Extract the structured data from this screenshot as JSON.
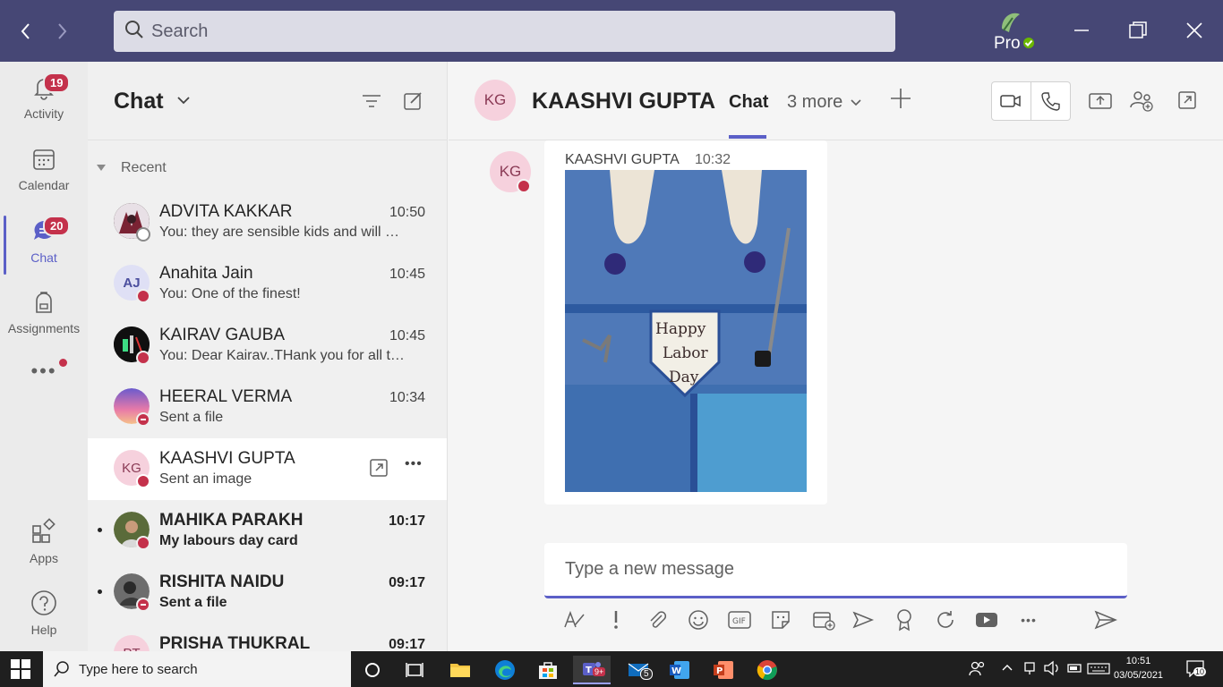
{
  "search": {
    "placeholder": "Search"
  },
  "profile": {
    "label": "Pro"
  },
  "rail": {
    "items": [
      {
        "label": "Activity",
        "badge": "19"
      },
      {
        "label": "Calendar"
      },
      {
        "label": "Chat",
        "badge": "20"
      },
      {
        "label": "Assignments"
      },
      {
        "label": "Apps"
      },
      {
        "label": "Help"
      }
    ]
  },
  "chatlist": {
    "title": "Chat",
    "section": "Recent",
    "chats": [
      {
        "name": "ADVITA KAKKAR",
        "time": "10:50",
        "preview": "You: they are sensible kids and will grow to be good human beings",
        "presence": "offline"
      },
      {
        "name": "Anahita Jain",
        "initials": "AJ",
        "time": "10:45",
        "preview": "You: One of the finest!",
        "presence": "busy"
      },
      {
        "name": "KAIRAV GAUBA",
        "time": "10:45",
        "preview": "You: Dear Kairav..THank you for all the wishes",
        "presence": "busy"
      },
      {
        "name": "HEERAL VERMA",
        "time": "10:34",
        "preview": "Sent a file",
        "presence": "dnd"
      },
      {
        "name": "KAASHVI GUPTA",
        "initials": "KG",
        "time": "",
        "preview": "Sent an image",
        "presence": "busy"
      },
      {
        "name": "MAHIKA PARAKH",
        "time": "10:17",
        "preview": "My labours day card",
        "presence": "busy"
      },
      {
        "name": "RISHITA NAIDU",
        "time": "09:17",
        "preview": "Sent a file",
        "presence": "dnd"
      },
      {
        "name": "PRISHA THUKRAL",
        "initials": "PT",
        "time": "09:17",
        "preview": "",
        "presence": "busy"
      }
    ]
  },
  "conversation": {
    "name": "KAASHVI GUPTA",
    "initials": "KG",
    "tab_chat": "Chat",
    "tab_more": "3 more",
    "message": {
      "sender": "KAASHVI GUPTA",
      "time": "10:32",
      "image_text": [
        "Happy",
        "Labor",
        "Day"
      ]
    },
    "composer_placeholder": "Type a new message"
  },
  "taskbar": {
    "search_placeholder": "Type here to search",
    "time": "10:51",
    "date": "03/05/2021",
    "teams_badge": "9+",
    "mail_badge": "5",
    "notif_badge": "10"
  }
}
